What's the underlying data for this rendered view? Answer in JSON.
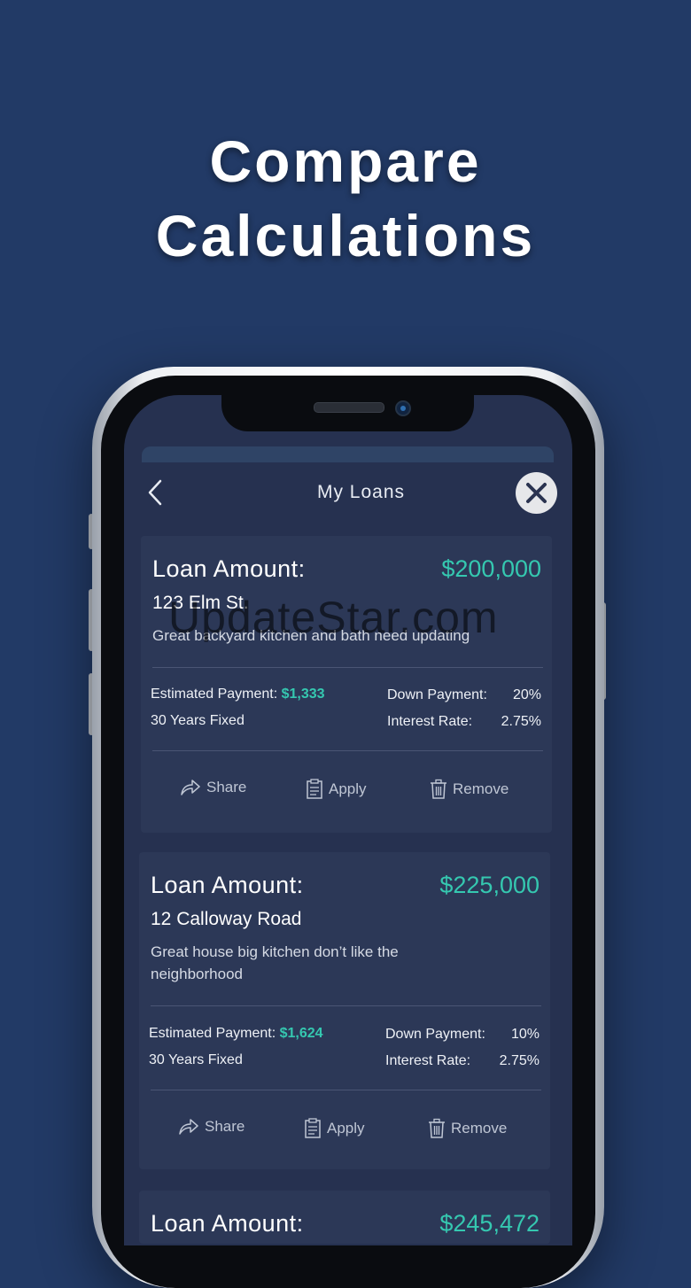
{
  "headline": {
    "line1": "Compare",
    "line2": "Calculations"
  },
  "nav": {
    "title": "My Loans",
    "back_icon": "chevron-left-icon",
    "close_icon": "close-icon"
  },
  "loans": [
    {
      "label": "Loan Amount:",
      "amount": "$200,000",
      "address": "123 Elm St.",
      "notes": "Great backyard kitchen and bath need updating",
      "estimated_label": "Estimated Payment:",
      "estimated_value": "$1,333",
      "term": "30 Years Fixed",
      "down_label": "Down Payment:",
      "down_value": "20%",
      "rate_label": "Interest Rate:",
      "rate_value": "2.75%",
      "share": "Share",
      "apply": "Apply",
      "remove": "Remove"
    },
    {
      "label": "Loan Amount:",
      "amount": "$225,000",
      "address": "12 Calloway Road",
      "notes": "Great house big kitchen don’t like the neighborhood",
      "estimated_label": "Estimated Payment:",
      "estimated_value": "$1,624",
      "term": "30 Years Fixed",
      "down_label": "Down Payment:",
      "down_value": "10%",
      "rate_label": "Interest Rate:",
      "rate_value": "2.75%",
      "share": "Share",
      "apply": "Apply",
      "remove": "Remove"
    },
    {
      "label": "Loan Amount:",
      "amount": "$245,472"
    }
  ],
  "watermark": "UpdateStar.com",
  "colors": {
    "background": "#223a66",
    "card": "#2c3857",
    "accent": "#35c8b0"
  }
}
